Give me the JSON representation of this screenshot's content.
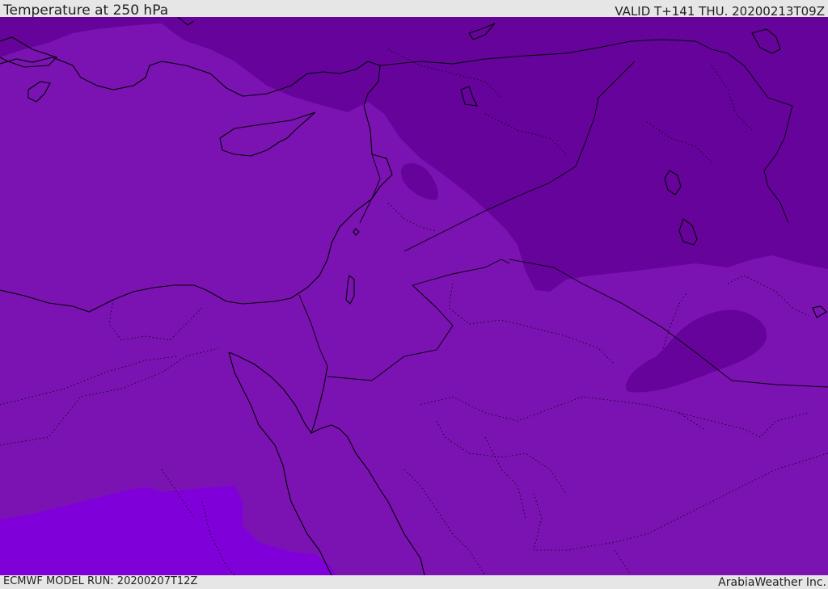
{
  "header": {
    "title": "Temperature at 250 hPa",
    "valid": "VALID T+141 THU. 20200213T09Z"
  },
  "footer": {
    "model_run": "ECMWF MODEL RUN: 20200207T12Z",
    "credit": "ArabiaWeather Inc."
  },
  "map": {
    "colors": {
      "base_field": "#7b13b3",
      "cold_field": "#66039b",
      "warm_field": "#7f00d9",
      "coastline": "#000000",
      "border": "#000000"
    }
  }
}
